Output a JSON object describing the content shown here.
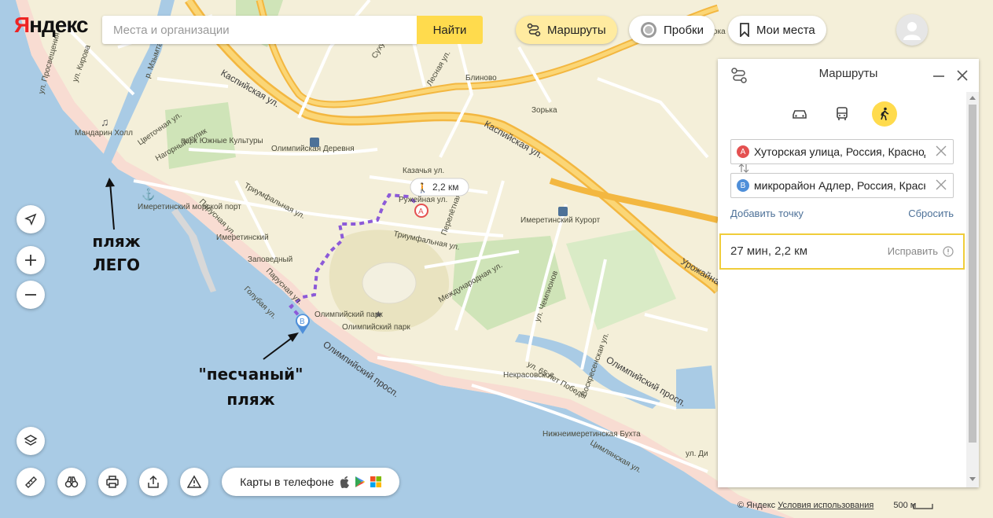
{
  "logo": {
    "first": "Я",
    "rest": "ндекс"
  },
  "search": {
    "placeholder": "Места и организации",
    "button": "Найти"
  },
  "header": {
    "routes": "Маршруты",
    "traffic": "Пробки",
    "my_places": "Мои места"
  },
  "map_labels": {
    "streets": [
      "ул. Просвещения",
      "ул. Кирова",
      "р. Мзымта",
      "Каспийская ул.",
      "Каспийская ул.",
      "Сухумское ш.",
      "Лесная ул.",
      "Цветочная ул.",
      "Нагорный тупик",
      "Триумфальная ул.",
      "Триумфальная ул.",
      "Парусная ул.",
      "Парусная ул.",
      "Голубая ул.",
      "Казачья ул.",
      "Ружейная ул.",
      "Перелётная ул.",
      "Международная ул.",
      "ул. Чемпионов",
      "Олимпийский просп.",
      "Олимпийский просп.",
      "Воскресенская ул.",
      "ул. 65 лет Победы",
      "Цимлянская ул.",
      "Урожайная ул.",
      "ул. Ди"
    ],
    "places": [
      "Мандарин Холл",
      "парк Южные Культуры",
      "Олимпийская Деревня",
      "Имеретинский морской порт",
      "Имеретинский",
      "Заповедный",
      "Олимпийский парк",
      "Олимпийский парк",
      "Имеретинский Курорт",
      "Некрасовское",
      "Нижнеимеретинская Бухта",
      "Блиново",
      "Зорька",
      "Зелёная горка"
    ],
    "route_badge": "2,2 км"
  },
  "markers": {
    "a": "A",
    "b": "B"
  },
  "annotations": {
    "lego": [
      "пляж",
      "ЛЕГО"
    ],
    "sandy": [
      "\"песчаный\"",
      "пляж"
    ]
  },
  "app_promo": {
    "label": "Карты в телефоне"
  },
  "panel": {
    "title": "Маршруты",
    "modes": [
      "car",
      "bus",
      "walk"
    ],
    "active_mode": "walk",
    "from": {
      "marker": "A",
      "value": "Хуторская улица, Россия, Краснодарский край"
    },
    "to": {
      "marker": "B",
      "value": "микрорайон Адлер, Россия, Краснодарский край"
    },
    "add_point": "Добавить точку",
    "reset": "Сбросить",
    "result": {
      "summary": "27 мин, 2,2 км",
      "fix": "Исправить"
    }
  },
  "footer": {
    "copyright": "© Яндекс",
    "terms": "Условия использования",
    "scale": "500 м"
  },
  "colors": {
    "sea": "#a9cbe5",
    "land": "#f4efd9",
    "highway": "#f3b740",
    "route": "#8c5ad8",
    "accent": "#ffdb4d",
    "marker": "#e45151",
    "marker_b": "#4f8fd9"
  }
}
